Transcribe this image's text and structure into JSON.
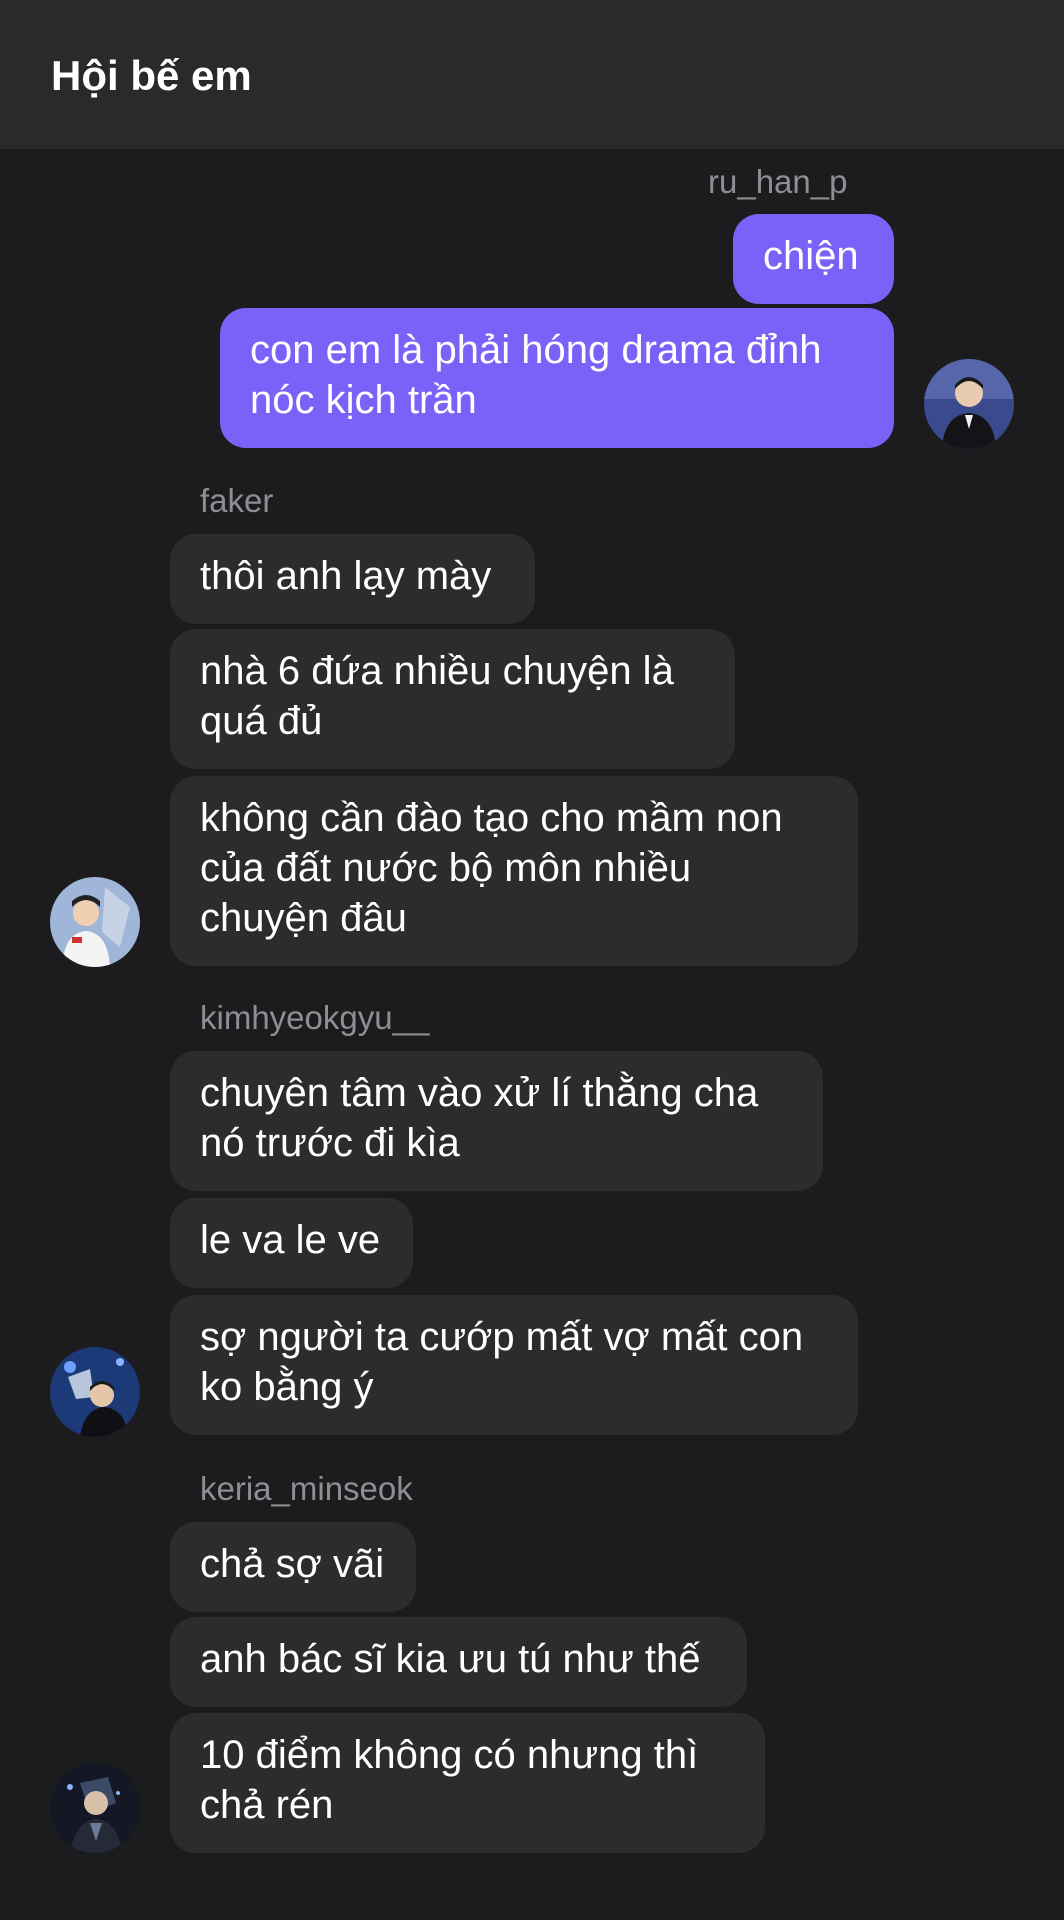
{
  "header": {
    "title": "Hội bế em"
  },
  "chat": {
    "groups": [
      {
        "sender": "ru_han_p",
        "side": "right",
        "messages": [
          "chiện",
          "con em là phải hóng drama đỉnh nóc kịch trần"
        ]
      },
      {
        "sender": "faker",
        "side": "left",
        "messages": [
          "thôi anh lạy mày",
          "nhà 6 đứa nhiều chuyện là quá đủ",
          "không cần đào tạo cho mầm non của đất nước bộ môn nhiều chuyện đâu"
        ]
      },
      {
        "sender": "kimhyeokgyu__",
        "side": "left",
        "messages": [
          "chuyên tâm vào xử lí thằng cha nó trước đi kìa",
          "le va le ve",
          "sợ người ta cướp mất vợ mất con ko bằng ý"
        ]
      },
      {
        "sender": "keria_minseok",
        "side": "left",
        "messages": [
          "chả sợ vãi",
          "anh bác sĩ kia ưu tú như thế",
          "10 điểm không có nhưng thì chả rén"
        ]
      }
    ]
  },
  "colors": {
    "background": "#1c1c1e",
    "header": "#2a2a2c",
    "my_bubble": "#7b61f8",
    "their_bubble": "#2c2c2e",
    "sender_text": "#8e8e93"
  }
}
